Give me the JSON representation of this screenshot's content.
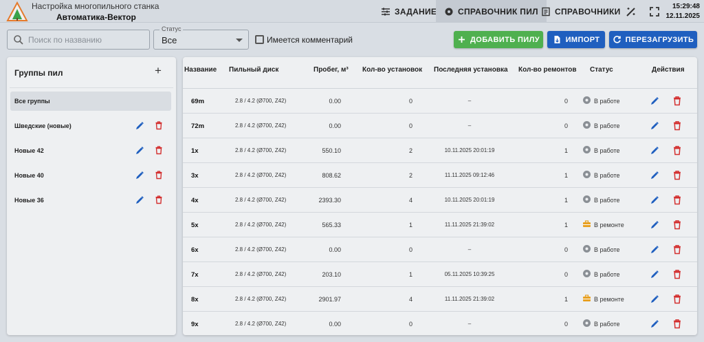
{
  "header": {
    "app_title": "Настройка многопильного станка",
    "app_subtitle": "Автоматика-Вектор",
    "nav": [
      {
        "label": "ЗАДАНИЕ",
        "icon": "sliders-icon"
      },
      {
        "label": "СПРАВОЧНИК ПИЛ",
        "icon": "gear-saw-icon",
        "active": true
      },
      {
        "label": "СПРАВОЧНИКИ",
        "icon": "book-icon"
      }
    ],
    "time": "15:29:48",
    "date": "12.11.2025",
    "colors": {
      "header_bg": "#d6dbe1",
      "active_tab": "#c4cad2"
    }
  },
  "toolbar": {
    "search_placeholder": "Поиск по названию",
    "status_label": "Статус",
    "status_value": "Все",
    "comment_checkbox_label": "Имеется комментарий",
    "comment_checked": false,
    "add_label": "ДОБАВИТЬ ПИЛУ",
    "import_label": "ИМПОРТ",
    "reload_label": "ПЕРЕЗАГРУЗИТЬ",
    "colors": {
      "add": "#4fb04f",
      "primary": "#1f5fbf"
    }
  },
  "groups": {
    "title": "Группы пил",
    "items": [
      {
        "label": "Все группы",
        "selected": true
      },
      {
        "label": "Шведские (новые)"
      },
      {
        "label": "Новые 42"
      },
      {
        "label": "Новые 40"
      },
      {
        "label": "Новые 36"
      }
    ]
  },
  "table": {
    "columns": [
      "Название",
      "Пильный диск",
      "Пробег, м³",
      "Кол-во установок",
      "Последняя установка",
      "Кол-во ремонтов",
      "Статус",
      "Действия"
    ],
    "rows": [
      {
        "name": "69m",
        "disk": "2.8 / 4.2 (Ø700, Z42)",
        "run": "0.00",
        "installs": "0",
        "last": "–",
        "repairs": "0",
        "status": "В работе",
        "status_kind": "work"
      },
      {
        "name": "72m",
        "disk": "2.8 / 4.2 (Ø700, Z42)",
        "run": "0.00",
        "installs": "0",
        "last": "–",
        "repairs": "0",
        "status": "В работе",
        "status_kind": "work"
      },
      {
        "name": "1x",
        "disk": "2.8 / 4.2 (Ø700, Z42)",
        "run": "550.10",
        "installs": "2",
        "last": "10.11.2025 20:01:19",
        "repairs": "1",
        "status": "В работе",
        "status_kind": "work"
      },
      {
        "name": "3x",
        "disk": "2.8 / 4.2 (Ø700, Z42)",
        "run": "808.62",
        "installs": "2",
        "last": "11.11.2025 09:12:46",
        "repairs": "1",
        "status": "В работе",
        "status_kind": "work"
      },
      {
        "name": "4x",
        "disk": "2.8 / 4.2 (Ø700, Z42)",
        "run": "2393.30",
        "installs": "4",
        "last": "10.11.2025 20:01:19",
        "repairs": "1",
        "status": "В работе",
        "status_kind": "work"
      },
      {
        "name": "5x",
        "disk": "2.8 / 4.2 (Ø700, Z42)",
        "run": "565.33",
        "installs": "1",
        "last": "11.11.2025 21:39:02",
        "repairs": "1",
        "status": "В ремонте",
        "status_kind": "repair"
      },
      {
        "name": "6x",
        "disk": "2.8 / 4.2 (Ø700, Z42)",
        "run": "0.00",
        "installs": "0",
        "last": "–",
        "repairs": "0",
        "status": "В работе",
        "status_kind": "work"
      },
      {
        "name": "7x",
        "disk": "2.8 / 4.2 (Ø700, Z42)",
        "run": "203.10",
        "installs": "1",
        "last": "05.11.2025 10:39:25",
        "repairs": "0",
        "status": "В работе",
        "status_kind": "work"
      },
      {
        "name": "8x",
        "disk": "2.8 / 4.2 (Ø700, Z42)",
        "run": "2901.97",
        "installs": "4",
        "last": "11.11.2025 21:39:02",
        "repairs": "1",
        "status": "В ремонте",
        "status_kind": "repair"
      },
      {
        "name": "9x",
        "disk": "2.8 / 4.2 (Ø700, Z42)",
        "run": "0.00",
        "installs": "0",
        "last": "–",
        "repairs": "0",
        "status": "В работе",
        "status_kind": "work"
      }
    ],
    "colors": {
      "edit": "#1f5fbf",
      "delete": "#d32f2f",
      "work": "#8a8f95",
      "repair": "#e8a020"
    }
  }
}
